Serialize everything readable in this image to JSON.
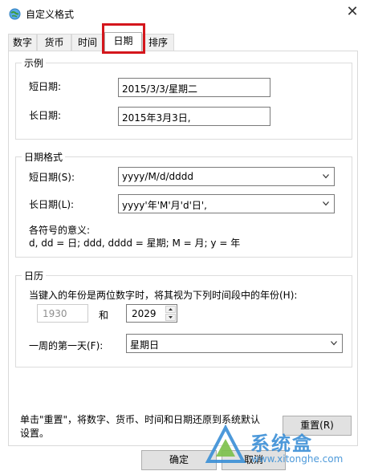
{
  "window": {
    "title": "自定义格式",
    "close_glyph": "✕"
  },
  "tabs": [
    {
      "label": "数字"
    },
    {
      "label": "货币"
    },
    {
      "label": "时间"
    },
    {
      "label": "日期"
    },
    {
      "label": "排序"
    }
  ],
  "active_tab": "日期",
  "sample": {
    "group_title": "示例",
    "short_label": "短日期:",
    "short_value": "2015/3/3/星期二",
    "long_label": "长日期:",
    "long_value": "2015年3月3日,"
  },
  "date_formats": {
    "group_title": "日期格式",
    "short_label": "短日期(S):",
    "short_value": "yyyy/M/d/dddd",
    "long_label": "长日期(L):",
    "long_value": "yyyy'年'M'月'd'日',",
    "legend_title": "各符号的意义:",
    "legend_text": "d, dd = 日; ddd, dddd = 星期; M = 月; y = 年"
  },
  "calendar": {
    "group_title": "日历",
    "two_digit_year_label": "当键入的年份是两位数字时，将其视为下列时间段中的年份(H):",
    "year_from": "1930",
    "and_label": "和",
    "year_to": "2029",
    "first_day_label": "一周的第一天(F):",
    "first_day_value": "星期日"
  },
  "reset": {
    "description": "单击\"重置\"，将数字、货币、时间和日期还原到系统默认设置。",
    "button_label": "重置(R)"
  },
  "footer": {
    "ok_label": "确定",
    "cancel_label": "取消"
  },
  "watermark": {
    "brand": "系统盒",
    "url": "www.xitonghe.com"
  },
  "colors": {
    "highlight_box": "#d4161c",
    "watermark": "#3a8fd6"
  }
}
